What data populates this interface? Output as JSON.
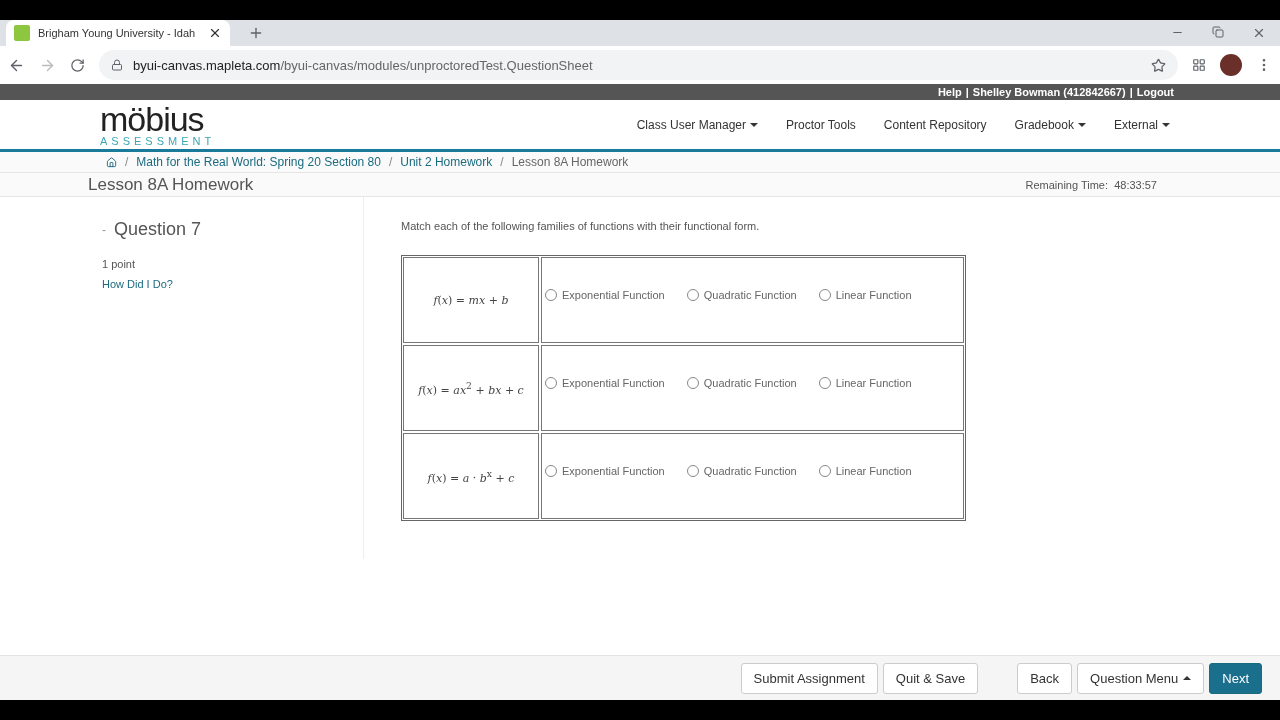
{
  "browser": {
    "tab_title": "Brigham Young University - Idah",
    "url_host": "byui-canvas.mapleta.com",
    "url_path": "/byui-canvas/modules/unproctoredTest.QuestionSheet"
  },
  "user_bar": {
    "help": "Help",
    "separator_1": "|",
    "user": "Shelley Bowman (412842667)",
    "separator_2": "|",
    "logout": "Logout"
  },
  "logo": {
    "word": "möbius",
    "sub": "ASSESSMENT"
  },
  "nav": [
    {
      "label": "Class User Manager",
      "dropdown": true
    },
    {
      "label": "Proctor Tools",
      "dropdown": false
    },
    {
      "label": "Content Repository",
      "dropdown": false
    },
    {
      "label": "Gradebook",
      "dropdown": true
    },
    {
      "label": "External",
      "dropdown": true
    }
  ],
  "breadcrumb": [
    {
      "separator": "/",
      "label": "Math for the Real World: Spring 20 Section 80",
      "current": false
    },
    {
      "separator": "/",
      "label": "Unit 2 Homework",
      "current": false
    },
    {
      "separator": "/",
      "label": "Lesson 8A Homework",
      "current": true
    }
  ],
  "page_title": "Lesson 8A Homework",
  "remaining_time": {
    "label": "Remaining Time:",
    "value": "48:33:57"
  },
  "question": {
    "toggle": "-",
    "title": "Question 7",
    "points": "1 point",
    "feedback_link": "How Did I Do?"
  },
  "prompt": "Match each of the following families of functions with their functional form.",
  "rows": [
    {
      "formula": "*f*(*x*) = *mx* + *b*",
      "options": [
        {
          "label": "Exponential Function",
          "selected": false
        },
        {
          "label": "Quadratic Function",
          "selected": false
        },
        {
          "label": "Linear Function",
          "selected": false
        }
      ]
    },
    {
      "formula": "*f*(*x*) = *ax*$^{2}$ + *bx* + *c*",
      "options": [
        {
          "label": "Exponential Function",
          "selected": false
        },
        {
          "label": "Quadratic Function",
          "selected": false
        },
        {
          "label": "Linear Function",
          "selected": false
        }
      ]
    },
    {
      "formula": "*f*(*x*) = *a* · *b*$^{x}$ + *c*",
      "options": [
        {
          "label": "Exponential Function",
          "selected": false
        },
        {
          "label": "Quadratic Function",
          "selected": false
        },
        {
          "label": "Linear Function",
          "selected": false
        }
      ]
    }
  ],
  "footer_buttons": [
    {
      "label": "Submit Assignment",
      "kind": "default",
      "caret": false
    },
    {
      "label": "Quit & Save",
      "kind": "default",
      "caret": false
    },
    {
      "label": "Back",
      "kind": "default",
      "caret": false
    },
    {
      "label": "Question Menu",
      "kind": "default",
      "caret": true
    },
    {
      "label": "Next",
      "kind": "primary",
      "caret": false
    }
  ]
}
